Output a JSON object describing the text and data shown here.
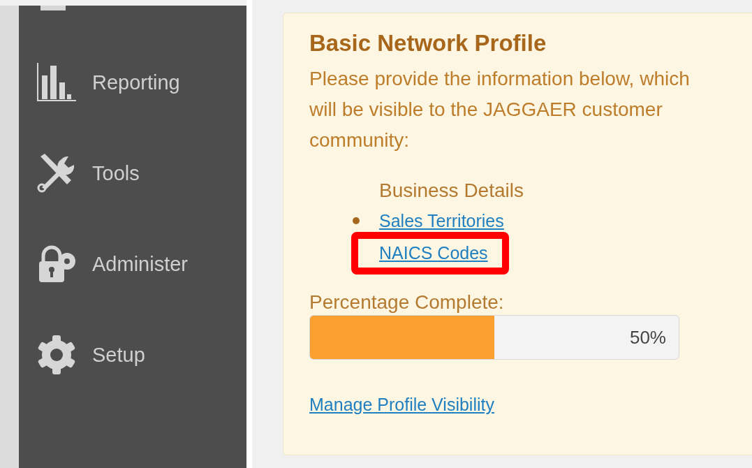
{
  "sidebar": {
    "items": [
      {
        "kind": "partial"
      },
      {
        "kind": "chart",
        "label": "Reporting"
      },
      {
        "kind": "tools",
        "label": "Tools"
      },
      {
        "kind": "lock",
        "label": "Administer"
      },
      {
        "kind": "gear",
        "label": "Setup"
      }
    ]
  },
  "card": {
    "title": "Basic Network Profile",
    "intro": "Please provide the information below, which will be visible to the JAGGAER customer community:",
    "section": "Business Details",
    "links": [
      {
        "label": "Sales Territories",
        "bullet": true,
        "highlighted": false
      },
      {
        "label": "NAICS Codes",
        "bullet": false,
        "highlighted": true
      }
    ],
    "progress_label": "Percentage Complete:",
    "progress": {
      "level": 0.5,
      "reading": "50%"
    },
    "footer_link": "Manage Profile Visibility"
  }
}
